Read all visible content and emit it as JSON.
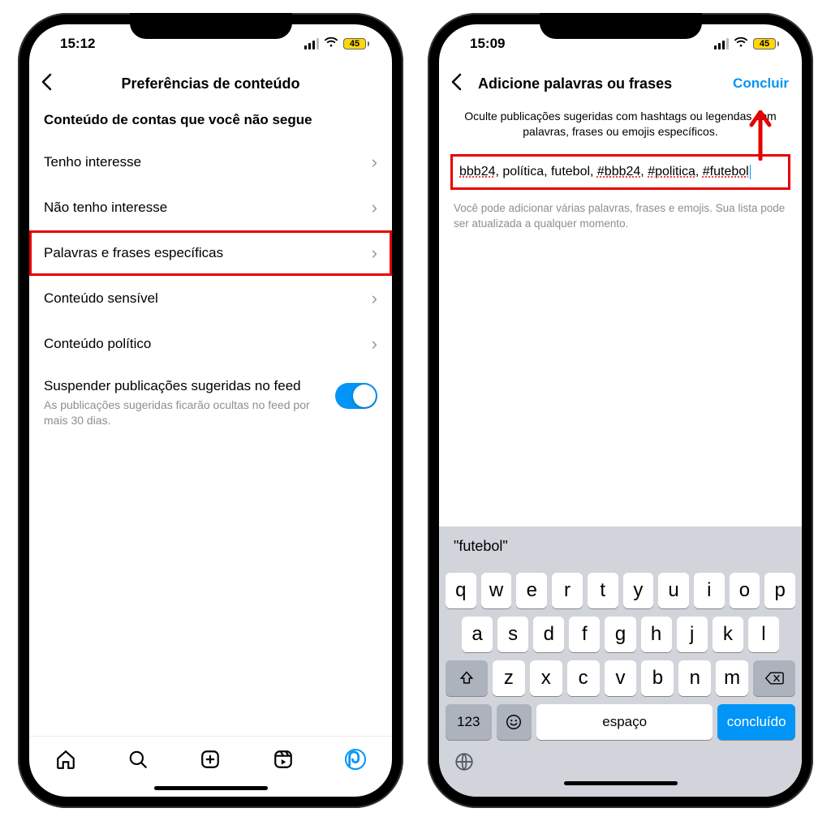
{
  "status": {
    "time_left": "15:12",
    "time_right": "15:09",
    "battery": "45"
  },
  "left": {
    "title": "Preferências de conteúdo",
    "section": "Conteúdo de contas que você não segue",
    "rows": {
      "interest": "Tenho interesse",
      "no_interest": "Não tenho interesse",
      "words": "Palavras e frases específicas",
      "sensitive": "Conteúdo sensível",
      "political": "Conteúdo político"
    },
    "toggle_title": "Suspender publicações sugeridas no feed",
    "toggle_sub": "As publicações sugeridas ficarão ocultas no feed por mais 30 dias."
  },
  "right": {
    "title": "Adicione palavras ou frases",
    "done": "Concluir",
    "help": "Oculte publicações sugeridas com hashtags ou legendas com palavras, frases ou emojis específicos.",
    "input_parts": {
      "w1": "bbb24",
      "sep1": ", política, futebol, ",
      "w2": "#bbb24",
      "sep2": ", ",
      "w3": "#politica",
      "sep3": ", ",
      "w4": "#futebol"
    },
    "hint": "Você pode adicionar várias palavras, frases e emojis. Sua lista pode ser atualizada a qualquer momento.",
    "candidate": "\"futebol\""
  },
  "keys": {
    "r1": [
      "q",
      "w",
      "e",
      "r",
      "t",
      "y",
      "u",
      "i",
      "o",
      "p"
    ],
    "r2": [
      "a",
      "s",
      "d",
      "f",
      "g",
      "h",
      "j",
      "k",
      "l"
    ],
    "r3": [
      "z",
      "x",
      "c",
      "v",
      "b",
      "n",
      "m"
    ],
    "num": "123",
    "space": "espaço",
    "done": "concluído"
  }
}
